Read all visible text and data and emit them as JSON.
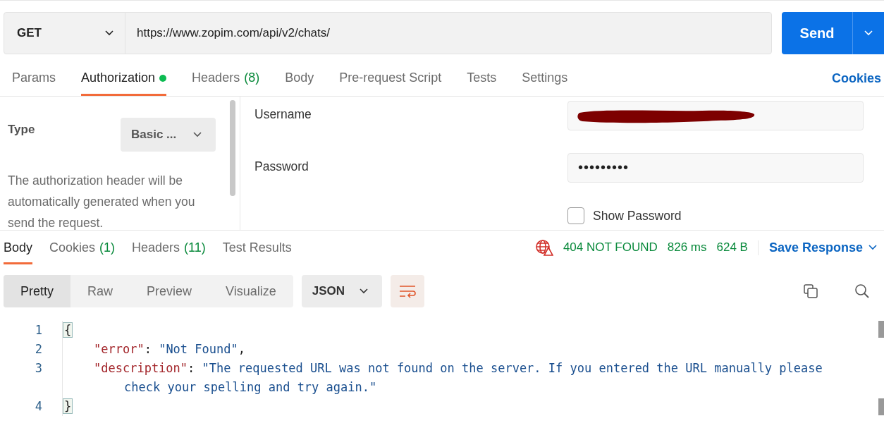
{
  "request": {
    "method": "GET",
    "url": "https://www.zopim.com/api/v2/chats/",
    "send_label": "Send"
  },
  "request_tabs": [
    {
      "label": "Params",
      "selected": false
    },
    {
      "label": "Authorization",
      "selected": true,
      "dot": true
    },
    {
      "label": "Headers",
      "count": "(8)",
      "selected": false
    },
    {
      "label": "Body",
      "selected": false
    },
    {
      "label": "Pre-request Script",
      "selected": false
    },
    {
      "label": "Tests",
      "selected": false
    },
    {
      "label": "Settings",
      "selected": false
    }
  ],
  "cookies_link": "Cookies",
  "auth": {
    "type_label": "Type",
    "type_value": "Basic ...",
    "description": "The authorization header will be automatically generated when you send the request.",
    "fields": [
      {
        "label": "Username",
        "kind": "redacted"
      },
      {
        "label": "Password",
        "kind": "password",
        "value": "•••••••••"
      }
    ],
    "show_password": {
      "label": "Show Password",
      "checked": false
    }
  },
  "response_tabs": [
    {
      "label": "Body",
      "selected": true
    },
    {
      "label": "Cookies",
      "count": "(1)",
      "selected": false
    },
    {
      "label": "Headers",
      "count": "(11)",
      "selected": false
    },
    {
      "label": "Test Results",
      "selected": false
    }
  ],
  "status": {
    "code": "404 NOT FOUND",
    "time": "826 ms",
    "size": "624 B",
    "save_label": "Save Response"
  },
  "view_modes": [
    {
      "label": "Pretty",
      "selected": true
    },
    {
      "label": "Raw",
      "selected": false
    },
    {
      "label": "Preview",
      "selected": false
    },
    {
      "label": "Visualize",
      "selected": false
    }
  ],
  "format": "JSON",
  "code_lines": [
    {
      "number": "1",
      "tokens": [
        {
          "kind": "bracket",
          "text": "{"
        }
      ]
    },
    {
      "number": "2",
      "tokens": [
        {
          "kind": "key",
          "text": "\"error\""
        },
        {
          "kind": "punct",
          "text": ": "
        },
        {
          "kind": "string",
          "text": "\"Not Found\""
        },
        {
          "kind": "punct",
          "text": ","
        }
      ]
    },
    {
      "number": "3",
      "tokens": [
        {
          "kind": "key",
          "text": "\"description\""
        },
        {
          "kind": "punct",
          "text": ": "
        },
        {
          "kind": "string",
          "text": "\"The requested URL was not found on the server. If you entered the URL manually please check your spelling and try again.\""
        }
      ]
    },
    {
      "number": "4",
      "tokens": [
        {
          "kind": "bracket",
          "text": "}"
        }
      ]
    }
  ]
}
